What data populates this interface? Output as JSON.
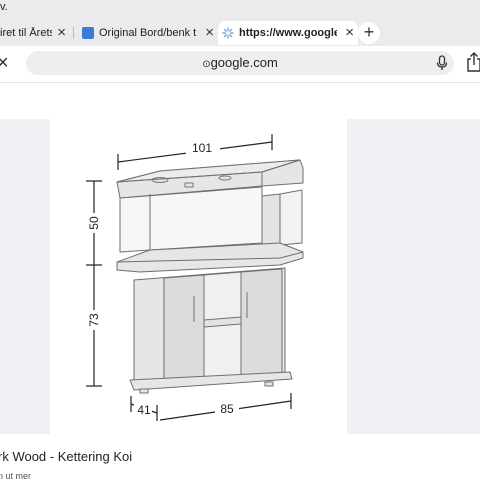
{
  "top_strip": {
    "text": "v."
  },
  "tabs": [
    {
      "label": "iret til Årets",
      "favicon": "generic-page-icon",
      "active": false
    },
    {
      "label": "Original Bord/benk til J",
      "favicon": "site-favicon-blue",
      "active": false
    },
    {
      "label": "https://www.google.co",
      "favicon": "loading-spinner-icon",
      "active": true
    }
  ],
  "toolbar": {
    "url": "google.com",
    "url_prefix_icon": "site-settings-icon"
  },
  "product": {
    "dimensions": {
      "width_top": "101",
      "height_tank": "50",
      "height_cabinet": "73",
      "depth": "41",
      "width_base": "85"
    },
    "caption": "rk Wood - Kettering Koi",
    "sub_caption": "n ut mer"
  },
  "colors": {
    "tab_strip": "#ebebee",
    "panel_gray": "#eff1f4",
    "line_art": "#6f6f6f",
    "furniture_fill": "#e6e6e6"
  }
}
